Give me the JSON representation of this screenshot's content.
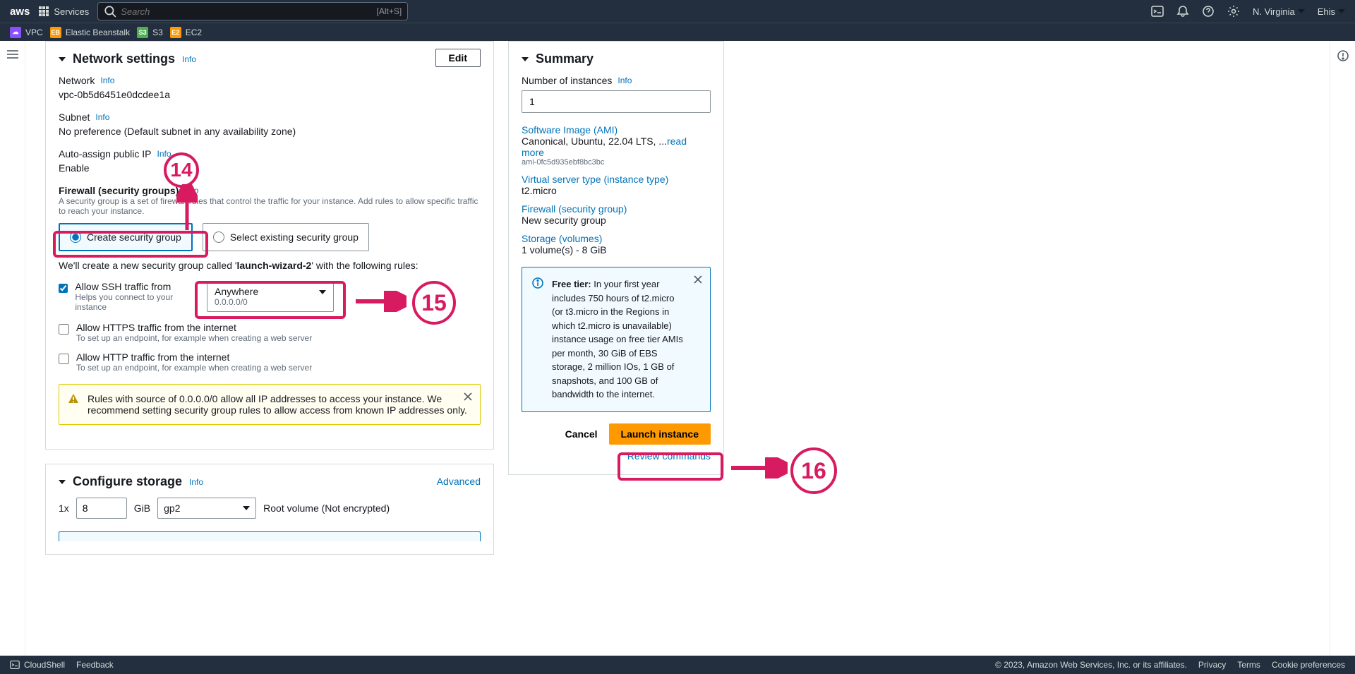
{
  "topnav": {
    "services": "Services",
    "search_placeholder": "Search",
    "search_shortcut": "[Alt+S]",
    "region": "N. Virginia",
    "account": "Ehis"
  },
  "favorites": {
    "vpc": "VPC",
    "eb": "Elastic Beanstalk",
    "s3": "S3",
    "ec2": "EC2"
  },
  "network": {
    "heading": "Network settings",
    "info": "Info",
    "edit": "Edit",
    "network_label": "Network",
    "network_value": "vpc-0b5d6451e0dcdee1a",
    "subnet_label": "Subnet",
    "subnet_value": "No preference (Default subnet in any availability zone)",
    "autoip_label": "Auto-assign public IP",
    "autoip_value": "Enable",
    "fw_heading": "Firewall (security groups)",
    "fw_desc": "A security group is a set of firewall rules that control the traffic for your instance. Add rules to allow specific traffic to reach your instance.",
    "create_sg": "Create security group",
    "select_sg": "Select existing security group",
    "sg_note_pre": "We'll create a new security group called '",
    "sg_name": "launch-wizard-2",
    "sg_note_post": "' with the following rules:",
    "ssh_label": "Allow SSH traffic from",
    "ssh_sub": "Helps you connect to your instance",
    "select_line1": "Anywhere",
    "select_line2": "0.0.0.0/0",
    "https_label": "Allow HTTPS traffic from the internet",
    "https_sub": "To set up an endpoint, for example when creating a web server",
    "http_label": "Allow HTTP traffic from the internet",
    "http_sub": "To set up an endpoint, for example when creating a web server",
    "warn_text": "Rules with source of 0.0.0.0/0 allow all IP addresses to access your instance. We recommend setting security group rules to allow access from known IP addresses only."
  },
  "storage": {
    "heading": "Configure storage",
    "info": "Info",
    "advanced": "Advanced",
    "prefix": "1x",
    "size": "8",
    "unit": "GiB",
    "type": "gp2",
    "suffix": "Root volume  (Not encrypted)"
  },
  "summary": {
    "heading": "Summary",
    "num_instances_label": "Number of instances",
    "info": "Info",
    "num_instances_value": "1",
    "ami_label": "Software Image (AMI)",
    "ami_value": "Canonical, Ubuntu, 22.04 LTS, ...",
    "ami_readmore": "read more",
    "ami_id": "ami-0fc5d935ebf8bc3bc",
    "itype_label": "Virtual server type (instance type)",
    "itype_value": "t2.micro",
    "fw_label": "Firewall (security group)",
    "fw_value": "New security group",
    "storage_label": "Storage (volumes)",
    "storage_value": "1 volume(s) - 8 GiB",
    "free_tier_bold": "Free tier:",
    "free_tier_text": " In your first year includes 750 hours of t2.micro (or t3.micro in the Regions in which t2.micro is unavailable) instance usage on free tier AMIs per month, 30 GiB of EBS storage, 2 million IOs, 1 GB of snapshots, and 100 GB of bandwidth to the internet.",
    "cancel": "Cancel",
    "launch": "Launch instance",
    "review": "Review commands"
  },
  "annotations": {
    "n14": "14",
    "n15": "15",
    "n16": "16"
  },
  "footer": {
    "cloudshell": "CloudShell",
    "feedback": "Feedback",
    "copyright": "© 2023, Amazon Web Services, Inc. or its affiliates.",
    "privacy": "Privacy",
    "terms": "Terms",
    "cookies": "Cookie preferences"
  }
}
